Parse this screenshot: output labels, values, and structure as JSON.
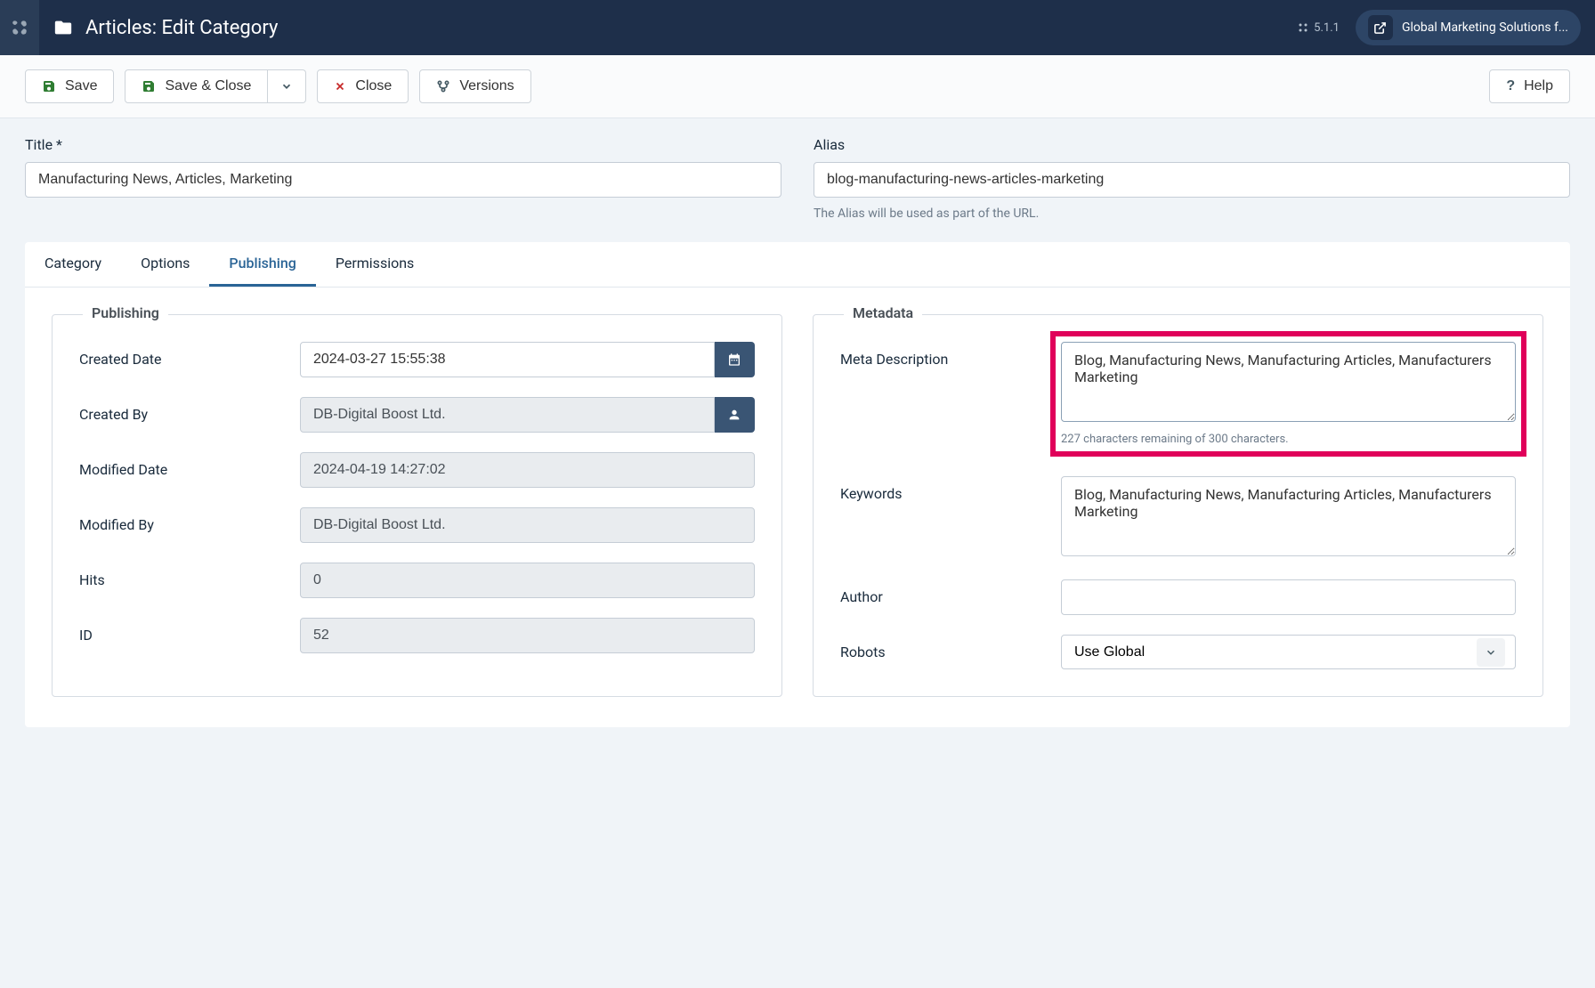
{
  "header": {
    "page_title": "Articles: Edit Category",
    "version": "5.1.1",
    "site_name": "Global Marketing Solutions f..."
  },
  "toolbar": {
    "save": "Save",
    "save_close": "Save & Close",
    "close": "Close",
    "versions": "Versions",
    "help": "Help"
  },
  "form": {
    "title_label": "Title *",
    "title_value": "Manufacturing News, Articles, Marketing",
    "alias_label": "Alias",
    "alias_value": "blog-manufacturing-news-articles-marketing",
    "alias_hint": "The Alias will be used as part of the URL."
  },
  "tabs": {
    "category": "Category",
    "options": "Options",
    "publishing": "Publishing",
    "permissions": "Permissions"
  },
  "publishing": {
    "legend": "Publishing",
    "created_date_label": "Created Date",
    "created_date_value": "2024-03-27 15:55:38",
    "created_by_label": "Created By",
    "created_by_value": "DB-Digital Boost Ltd.",
    "modified_date_label": "Modified Date",
    "modified_date_value": "2024-04-19 14:27:02",
    "modified_by_label": "Modified By",
    "modified_by_value": "DB-Digital Boost Ltd.",
    "hits_label": "Hits",
    "hits_value": "0",
    "id_label": "ID",
    "id_value": "52"
  },
  "metadata": {
    "legend": "Metadata",
    "meta_desc_label": "Meta Description",
    "meta_desc_value": "Blog, Manufacturing News, Manufacturing Articles, Manufacturers Marketing",
    "meta_desc_hint": "227 characters remaining of 300 characters.",
    "keywords_label": "Keywords",
    "keywords_value": "Blog, Manufacturing News, Manufacturing Articles, Manufacturers Marketing",
    "author_label": "Author",
    "author_value": "",
    "robots_label": "Robots",
    "robots_value": "Use Global"
  }
}
